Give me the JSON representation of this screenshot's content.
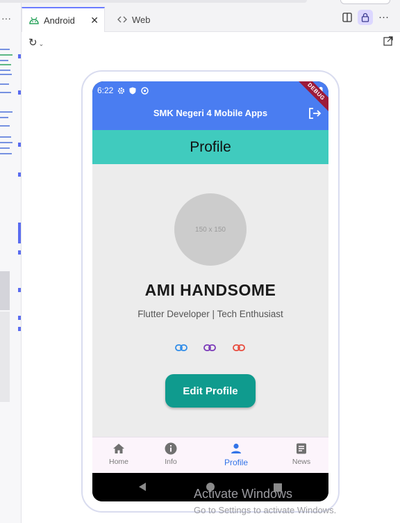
{
  "tabs": [
    {
      "label": "Android",
      "icon": "android-icon",
      "active": true
    },
    {
      "label": "Web",
      "icon": "code-icon",
      "active": false
    }
  ],
  "status_bar": {
    "time": "6:22",
    "debug": "DEBUG"
  },
  "app": {
    "title": "SMK Negeri 4 Mobile Apps",
    "header": "Profile",
    "accent_appbar": "#4a7df1",
    "accent_header": "#40cbbe"
  },
  "profile": {
    "avatar_placeholder": "150 x 150",
    "name": "AMI HANDSOME",
    "subtitle": "Flutter Developer | Tech Enthusiast",
    "edit_label": "Edit Profile",
    "links": [
      {
        "icon": "link-icon",
        "color": "#2f8ce8"
      },
      {
        "icon": "link-icon",
        "color": "#7a38b8"
      },
      {
        "icon": "link-icon",
        "color": "#e84a3c"
      }
    ]
  },
  "bottom_nav": [
    {
      "label": "Home",
      "icon": "home-icon",
      "active": false
    },
    {
      "label": "Info",
      "icon": "info-icon",
      "active": false
    },
    {
      "label": "Profile",
      "icon": "person-icon",
      "active": true
    },
    {
      "label": "News",
      "icon": "news-icon",
      "active": false
    }
  ],
  "watermark": {
    "title": "Activate Windows",
    "subtitle": "Go to Settings to activate Windows."
  }
}
